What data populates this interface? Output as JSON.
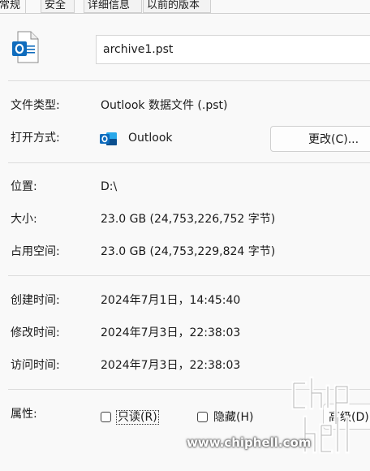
{
  "tabs": [
    {
      "label": "常规",
      "active": true
    },
    {
      "label": "安全",
      "active": false
    },
    {
      "label": "详细信息",
      "active": false
    },
    {
      "label": "以前的版本",
      "active": false
    }
  ],
  "file": {
    "icon": "outlook-data-file-icon",
    "name": "archive1.pst"
  },
  "props": {
    "type_label": "文件类型:",
    "type_value": "Outlook 数据文件 (.pst)",
    "opens_with_label": "打开方式:",
    "opens_with_app": "Outlook",
    "app_icon": "outlook-icon",
    "change_button": "更改(C)...",
    "location_label": "位置:",
    "location_value": "D:\\",
    "size_label": "大小:",
    "size_value": "23.0 GB (24,753,226,752 字节)",
    "disk_size_label": "占用空间:",
    "disk_size_value": "23.0 GB (24,753,229,824 字节)",
    "created_label": "创建时间:",
    "created_value": "2024年7月1日，14:45:40",
    "modified_label": "修改时间:",
    "modified_value": "2024年7月3日，22:38:03",
    "accessed_label": "访问时间:",
    "accessed_value": "2024年7月3日，22:38:03",
    "attributes_label": "属性:",
    "readonly_label": "只读(R)",
    "readonly_checked": false,
    "hidden_label": "隐藏(H)",
    "hidden_checked": false,
    "advanced_button": "高级(D)..."
  },
  "watermark": {
    "site": "www.chiphell.com"
  },
  "colors": {
    "outlook_blue": "#0f6cbd",
    "outlook_dark": "#0a4f8f",
    "background": "#f9f9f9"
  }
}
